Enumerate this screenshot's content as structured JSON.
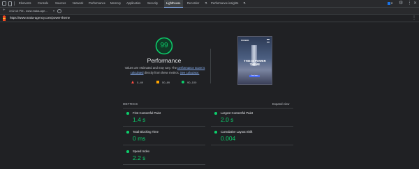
{
  "devtools": {
    "tabs": [
      "Elements",
      "Console",
      "Sources",
      "Network",
      "Performance",
      "Memory",
      "Application",
      "Security",
      "Lighthouse",
      "Recorder",
      "Performance insights"
    ],
    "active_tab": "Lighthouse",
    "issues_count": "2",
    "report_selector": "3:02:15 PM - www.maka-age...",
    "url": "https://www.maka-agency.com/power-theme"
  },
  "performance": {
    "score": "99",
    "title": "Performance",
    "desc_prefix": "Values are estimated and may vary. The ",
    "desc_link1": "performance score is calculated",
    "desc_mid": " directly from these metrics. ",
    "desc_link2": "See calculator.",
    "legend": [
      "0–49",
      "50–89",
      "90–100"
    ],
    "score_color": "#0cce6b"
  },
  "thumbnail": {
    "brand": "POWER.",
    "title_line1": "THIS IS POWER",
    "title_line2": "THEME",
    "button": "Read more"
  },
  "metrics": {
    "label": "METRICS",
    "expand": "Expand view",
    "items": [
      {
        "name": "First Contentful Paint",
        "value": "1.4 s"
      },
      {
        "name": "Largest Contentful Paint",
        "value": "2.0 s"
      },
      {
        "name": "Total Blocking Time",
        "value": "0 ms"
      },
      {
        "name": "Cumulative Layout Shift",
        "value": "0.004"
      },
      {
        "name": "Speed Index",
        "value": "2.2 s"
      }
    ]
  },
  "colors": {
    "pass": "#0cce6b",
    "average": "#ffa400",
    "fail": "#ff4e42",
    "link": "#8ab4f8"
  }
}
